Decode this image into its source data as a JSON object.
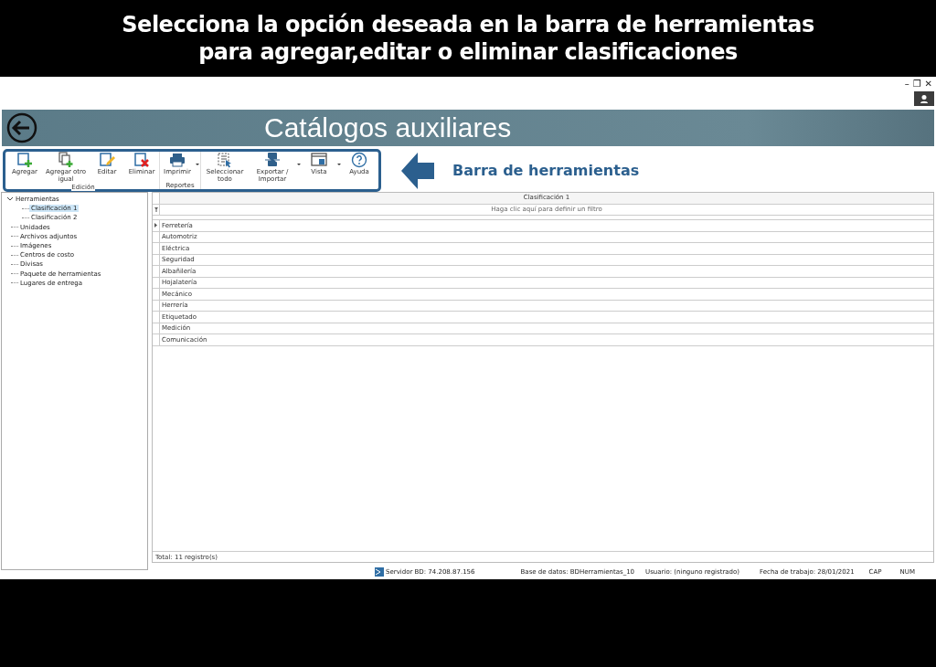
{
  "banner": {
    "lines": [
      "Selecciona la opción deseada en la barra de herramientas",
      "para agregar,editar o eliminar clasificaciones"
    ]
  },
  "window_controls": [
    "–",
    "❐",
    "✕"
  ],
  "header": {
    "title": "Catálogos auxiliares"
  },
  "toolbar": {
    "groups": [
      {
        "label": "Edición",
        "buttons": [
          {
            "label": "Agregar",
            "dropdown": false
          },
          {
            "label": "Agregar otro igual",
            "dropdown": false
          },
          {
            "label": "Editar",
            "dropdown": false
          },
          {
            "label": "Eliminar",
            "dropdown": false
          }
        ]
      },
      {
        "label": "Reportes",
        "buttons": [
          {
            "label": "Imprimir",
            "dropdown": true
          }
        ]
      },
      {
        "buttons": [
          {
            "label": "Seleccionar todo",
            "dropdown": false
          },
          {
            "label": "Exportar / Importar",
            "dropdown": true
          },
          {
            "label": "Vista",
            "dropdown": true
          },
          {
            "label": "Ayuda",
            "dropdown": false
          }
        ]
      }
    ]
  },
  "annotation": {
    "label": "Barra de herramientas"
  },
  "tree": [
    {
      "label": "Herramientas",
      "expanded": true,
      "selected": false,
      "children": [
        {
          "label": "Clasificación 1",
          "selected": true
        },
        {
          "label": "Clasificación 2",
          "selected": false
        }
      ]
    },
    {
      "label": "Unidades",
      "selected": false
    },
    {
      "label": "Archivos adjuntos",
      "selected": false
    },
    {
      "label": "Imágenes",
      "selected": false
    },
    {
      "label": "Centros de costo",
      "selected": false
    },
    {
      "label": "Divisas",
      "selected": false
    },
    {
      "label": "Paquete de herramientas",
      "selected": false
    },
    {
      "label": "Lugares de entrega",
      "selected": false
    }
  ],
  "table": {
    "columns": [
      "Clasificación 1"
    ],
    "filter_placeholder": "Haga clic aquí para definir un filtro",
    "rows": [
      {
        "cells": [
          "Ferretería"
        ],
        "selected": true
      },
      {
        "cells": [
          "Automotriz"
        ],
        "selected": false
      },
      {
        "cells": [
          "Eléctrica"
        ],
        "selected": false
      },
      {
        "cells": [
          "Seguridad"
        ],
        "selected": false
      },
      {
        "cells": [
          "Albañilería"
        ],
        "selected": false
      },
      {
        "cells": [
          "Hojalatería"
        ],
        "selected": false
      },
      {
        "cells": [
          "Mecánico"
        ],
        "selected": false
      },
      {
        "cells": [
          "Herrería"
        ],
        "selected": false
      },
      {
        "cells": [
          "Etiquetado"
        ],
        "selected": false
      },
      {
        "cells": [
          "Medición"
        ],
        "selected": false
      },
      {
        "cells": [
          "Comunicación"
        ],
        "selected": false
      }
    ],
    "footer": "Total: 11 registro(s)"
  },
  "status_bar": [
    "Servidor BD: 74.208.87.156",
    "Base de datos: BDHerramientas_10",
    "Usuario: (ninguno registrado)",
    "Fecha de trabajo: 28/01/2021",
    "CAP",
    "NUM"
  ]
}
